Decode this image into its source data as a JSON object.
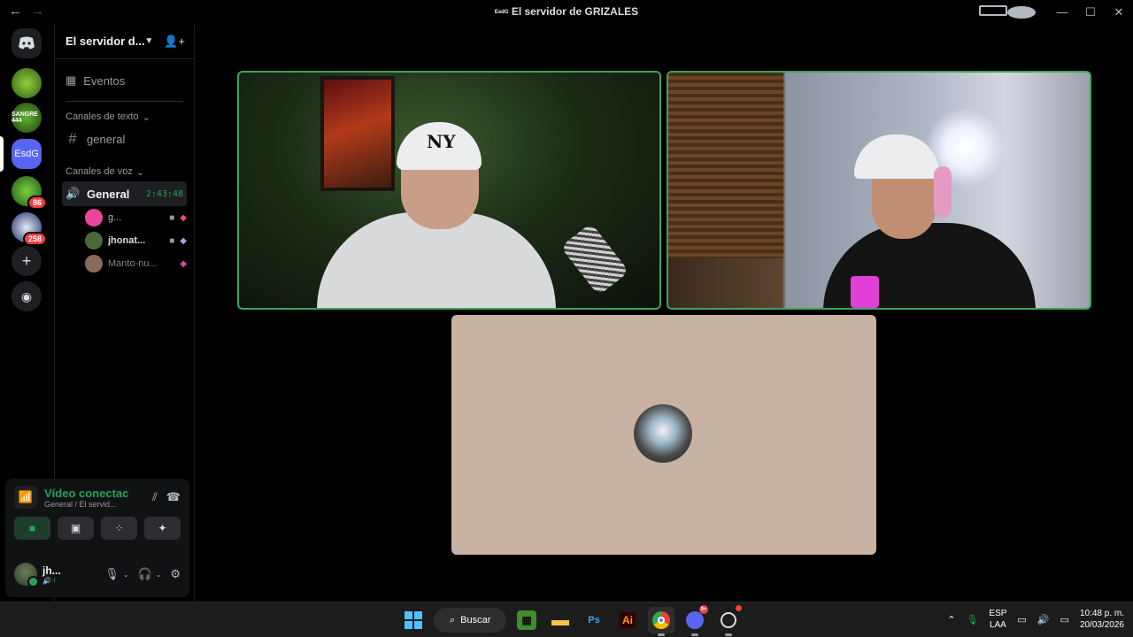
{
  "window": {
    "title": "El servidor de GRIZALES",
    "title_badge": "EsdG"
  },
  "server_rail": {
    "items": [
      {
        "name": "discord-home",
        "color": "#1e1f22"
      },
      {
        "name": "server-1",
        "color": "#4d7a2a"
      },
      {
        "name": "server-2",
        "color": "#2f6b1c",
        "label_text": "SANGRE 444"
      },
      {
        "name": "server-esdg",
        "text": "EsdG",
        "color": "#5865f2"
      },
      {
        "name": "server-4",
        "color": "#3a7a22",
        "badge": "86"
      },
      {
        "name": "server-5",
        "color": "#1b2f6b",
        "badge": "258"
      }
    ]
  },
  "sidebar": {
    "server_name": "El servidor d...",
    "events_label": "Eventos",
    "text_category": "Canales de texto",
    "text_channels": [
      {
        "name": "general"
      }
    ],
    "voice_category": "Canales de voz",
    "voice_channel": {
      "name": "General",
      "timer": "2:43:48"
    },
    "voice_users": [
      {
        "name": "g...",
        "avatar_color": "#eb459e",
        "has_video": true,
        "activity": "pink"
      },
      {
        "name": "jhonat...",
        "avatar_color": "#4a6a3a",
        "has_video": true,
        "activity": "blue"
      },
      {
        "name": "Manto-nu...",
        "avatar_color": "#8a6b5a",
        "has_video": false,
        "activity": "pink"
      }
    ]
  },
  "voice_panel": {
    "status": "Vídeo conectac",
    "location": "General / El servid..."
  },
  "user_panel": {
    "name": "jh...",
    "status": "🔊·!"
  },
  "taskbar": {
    "search_label": "Buscar",
    "lang_line1": "ESP",
    "lang_line2": "LAA",
    "time": "10:48 p. m.",
    "date": "20/03/2026",
    "discord_badge": "9+"
  },
  "colors": {
    "accent_green": "#23a55a",
    "speaking_border": "#3ba55c",
    "tile3_bg": "#c8b2a2"
  }
}
